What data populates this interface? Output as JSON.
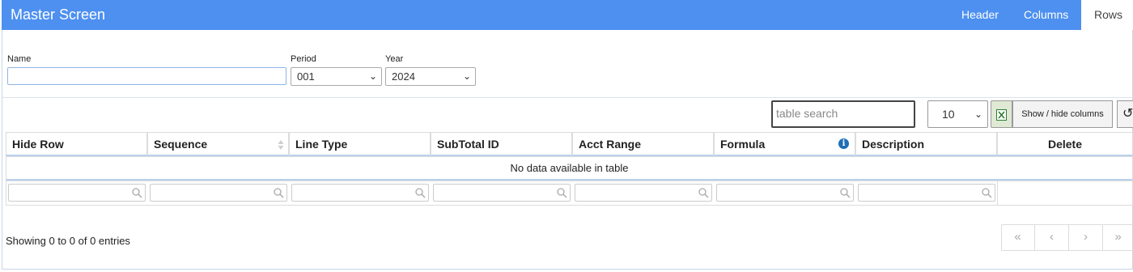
{
  "app": {
    "title": "Master Screen"
  },
  "tabs": [
    {
      "label": "Header"
    },
    {
      "label": "Columns"
    },
    {
      "label": "Rows",
      "active": true
    }
  ],
  "form": {
    "name_label": "Name",
    "name_value": "",
    "period_label": "Period",
    "period_value": "001",
    "year_label": "Year",
    "year_value": "2024"
  },
  "toolbar": {
    "search_placeholder": "table search",
    "page_size": "10",
    "excel_icon": "excel-export-icon",
    "show_hide_label": "Show / hide columns",
    "reset_icon": "reset-icon"
  },
  "table": {
    "columns": [
      "Hide Row",
      "Sequence",
      "Line Type",
      "SubTotal ID",
      "Acct Range",
      "Formula",
      "Description",
      "Delete"
    ],
    "empty_message": "No data available in table"
  },
  "footer": {
    "info": "Showing 0 to 0 of 0 entries",
    "pager": [
      "«",
      "‹",
      "›",
      "»"
    ]
  },
  "colors": {
    "header_bar": "#4d90f0",
    "accent_border": "#b9d1ec"
  }
}
